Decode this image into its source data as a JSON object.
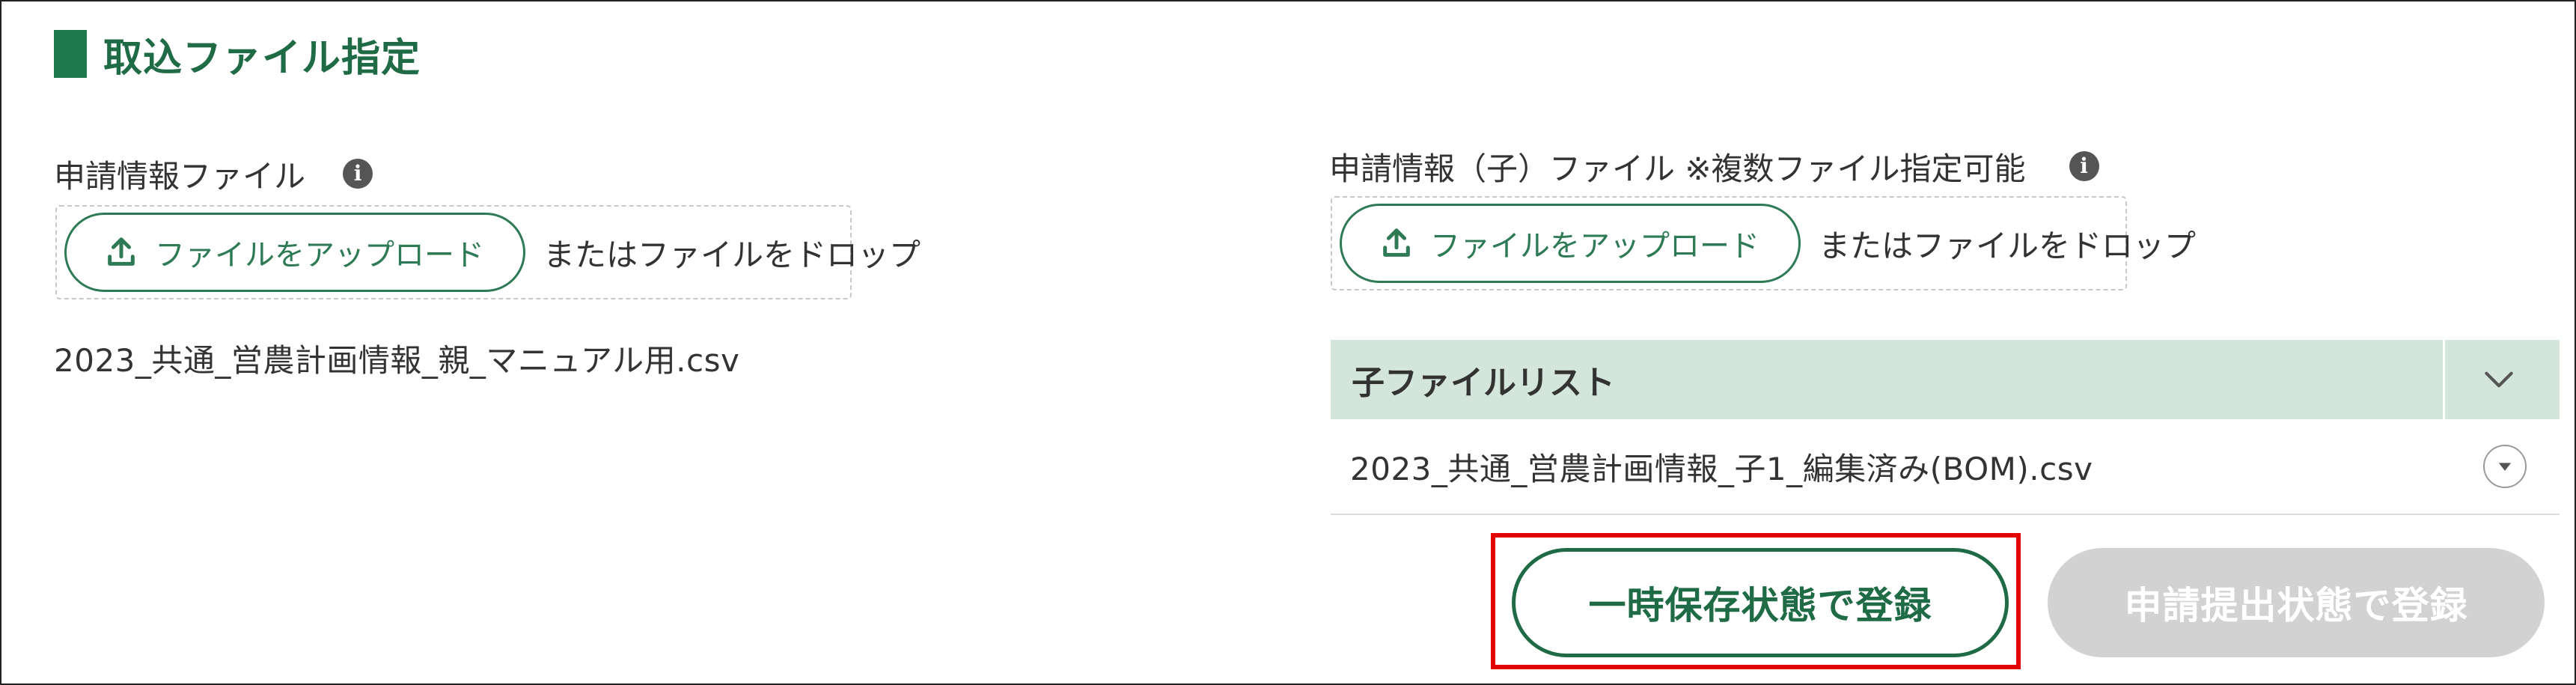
{
  "section": {
    "title": "取込ファイル指定"
  },
  "parent_file": {
    "label": "申請情報ファイル",
    "info_icon": "i",
    "upload_label": "ファイルをアップロード",
    "drop_label": "またはファイルをドロップ",
    "selected_file": "2023_共通_営農計画情報_親_マニュアル用.csv"
  },
  "child_file": {
    "label": "申請情報（子）ファイル ※複数ファイル指定可能",
    "info_icon": "i",
    "upload_label": "ファイルをアップロード",
    "drop_label": "またはファイルをドロップ"
  },
  "child_list": {
    "header": "子ファイルリスト",
    "rows": [
      {
        "name": "2023_共通_営農計画情報_子1_編集済み(BOM).csv"
      }
    ]
  },
  "actions": {
    "save_label": "一時保存状態で登録",
    "submit_label": "申請提出状態で登録",
    "submit_disabled": true
  },
  "colors": {
    "accent": "#1e6b45",
    "list_header_bg": "#d4e6dc",
    "highlight": "#e30000",
    "disabled": "#d2d2d2"
  }
}
